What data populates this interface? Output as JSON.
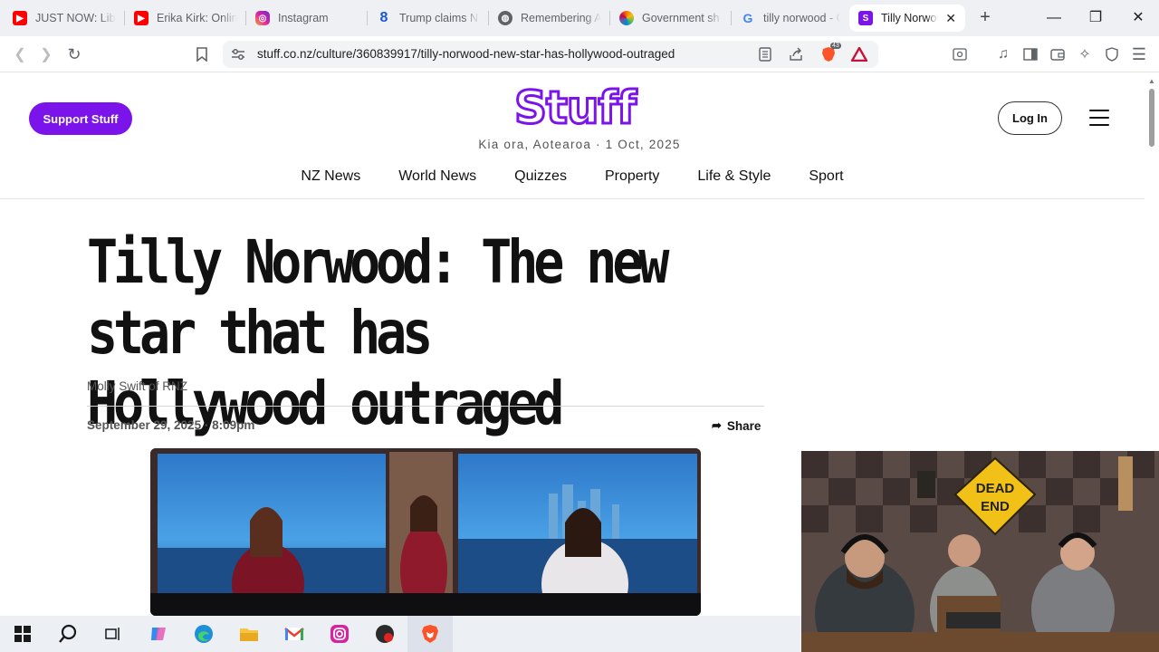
{
  "tabs": [
    {
      "label": "JUST NOW: Libe",
      "icon": "youtube-icon",
      "color": "#ff0000"
    },
    {
      "label": "Erika Kirk: Onlin",
      "icon": "youtube-icon",
      "color": "#ff0000"
    },
    {
      "label": "Instagram",
      "icon": "instagram-icon",
      "color": "#d6249f"
    },
    {
      "label": "Trump claims N",
      "icon": "newshub-icon",
      "color": "#1a56db"
    },
    {
      "label": "Remembering A",
      "icon": "globe-icon",
      "color": "#5f6368"
    },
    {
      "label": "Government sh",
      "icon": "nbc-peacock-icon",
      "color": "#ef7c00"
    },
    {
      "label": "tilly norwood - G",
      "icon": "google-icon",
      "color": "#4285f4"
    },
    {
      "label": "Tilly Norwood",
      "icon": "stuff-icon",
      "color": "#7b14ea",
      "active": true
    }
  ],
  "toolbar": {
    "url": "stuff.co.nz/culture/360839917/tilly-norwood-new-star-has-hollywood-outraged",
    "shield_count": "43"
  },
  "site": {
    "support_label": "Support Stuff",
    "logo": "Stuff",
    "greeting": "Kia ora, Aotearoa · 1 Oct, 2025",
    "login_label": "Log In",
    "brand_color": "#7b14ea",
    "nav": [
      "NZ News",
      "World News",
      "Quizzes",
      "Property",
      "Life & Style",
      "Sport"
    ]
  },
  "article": {
    "headline": "Tilly Norwood: The new star that has Hollywood outraged",
    "byline": "Molly Swift of RNZ",
    "date": "September 29, 2025 · 8:09pm",
    "share_label": "Share"
  },
  "video": {
    "sign_text": "DEAD END"
  }
}
